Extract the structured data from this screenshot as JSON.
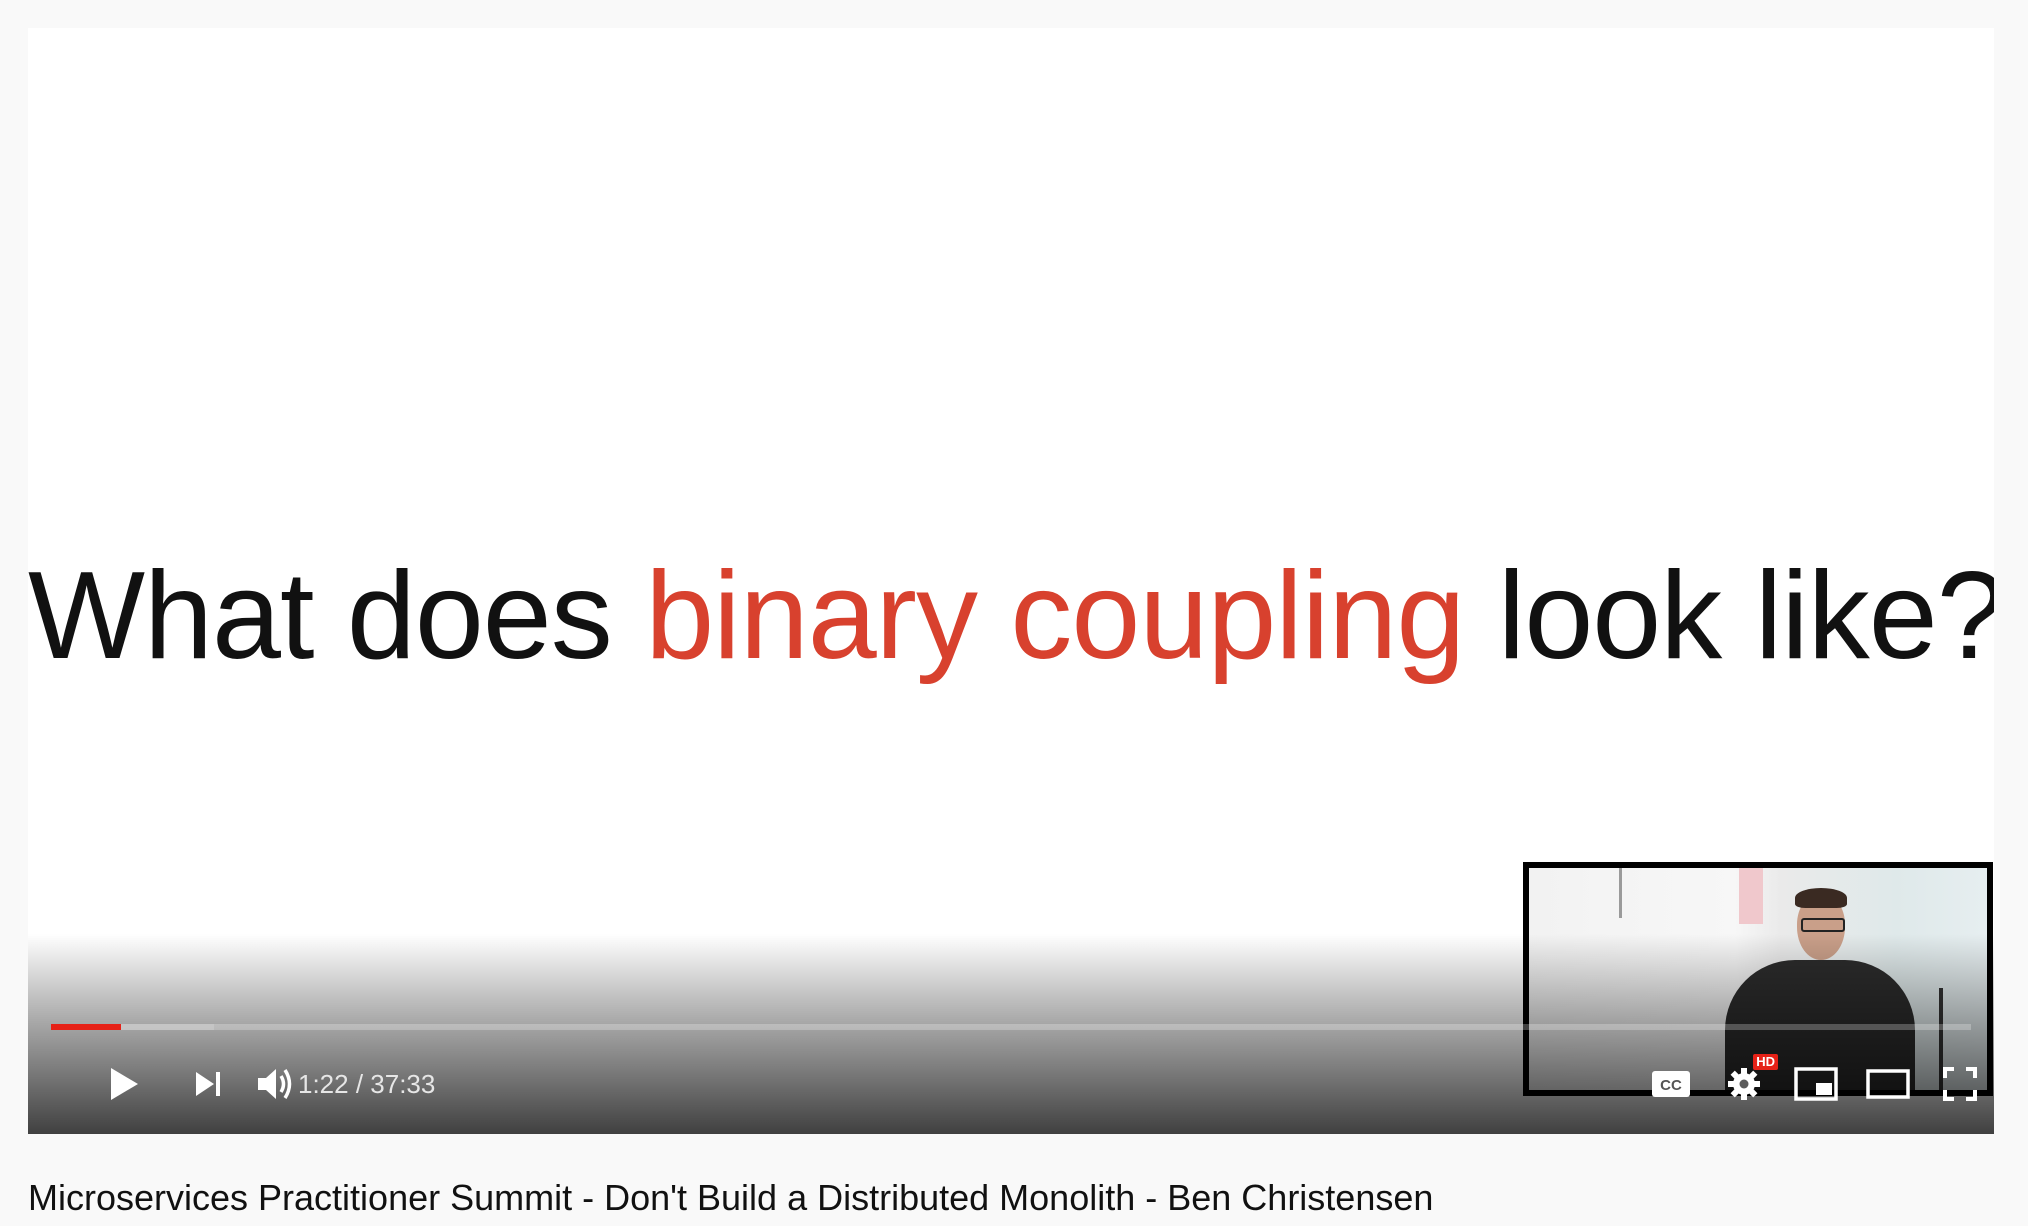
{
  "slide": {
    "part1": "What does ",
    "highlight": "binary coupling",
    "part2": " look like?",
    "highlight_color": "#d8412e"
  },
  "player": {
    "current_time": "1:22",
    "separator": " / ",
    "duration": "37:33",
    "progress_fraction": 0.0365,
    "buffered_fraction": 0.085,
    "progress_color": "#e62117",
    "hd_badge": "HD",
    "icons": {
      "play": "play-icon",
      "next": "next-icon",
      "volume": "volume-icon",
      "captions": "cc-icon",
      "settings": "gear-icon",
      "miniplayer": "miniplayer-icon",
      "theater": "theater-mode-icon",
      "fullscreen": "fullscreen-icon"
    }
  },
  "video": {
    "title": "Microservices Practitioner Summit - Don't Build a Distributed Monolith - Ben Christensen"
  }
}
